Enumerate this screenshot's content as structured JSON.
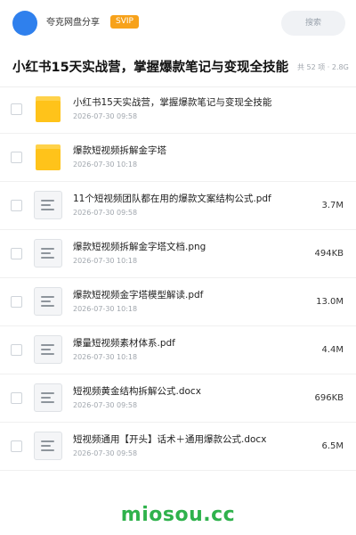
{
  "header": {
    "share_label": "夸克网盘分享",
    "badge": "SVIP",
    "search_label": "搜索"
  },
  "title": "小红书15天实战营，掌握爆款笔记与变现全技能",
  "meta": "共 52 项 · 2.8G",
  "files": [
    {
      "type": "folder",
      "name": "小红书15天实战营，掌握爆款笔记与变现全技能",
      "date": "2026-07-30 09:58",
      "size": ""
    },
    {
      "type": "folder",
      "name": "爆款短视频拆解金字塔",
      "date": "2026-07-30 10:18",
      "size": ""
    },
    {
      "type": "file",
      "name": "11个短视频团队都在用的爆款文案结构公式.pdf",
      "date": "2026-07-30 09:58",
      "size": "3.7M"
    },
    {
      "type": "file",
      "name": "爆款短视频拆解金字塔文档.png",
      "date": "2026-07-30 10:18",
      "size": "494KB"
    },
    {
      "type": "file",
      "name": "爆款短视频金字塔模型解读.pdf",
      "date": "2026-07-30 10:18",
      "size": "13.0M"
    },
    {
      "type": "file",
      "name": "爆量短视频素材体系.pdf",
      "date": "2026-07-30 10:18",
      "size": "4.4M"
    },
    {
      "type": "file",
      "name": "短视频黄金结构拆解公式.docx",
      "date": "2026-07-30 09:58",
      "size": "696KB"
    },
    {
      "type": "file",
      "name": "短视频通用【开头】话术＋通用爆款公式.docx",
      "date": "2026-07-30 09:58",
      "size": "6.5M"
    }
  ],
  "watermark": "miosou.cc",
  "colors": {
    "accent": "#2f80ed",
    "svip": "#f7a21b",
    "folder": "#ffc31a",
    "watermark": "#2fb24c"
  }
}
